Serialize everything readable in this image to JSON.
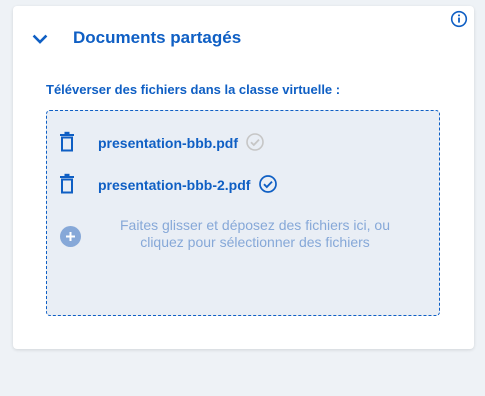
{
  "card": {
    "title": "Documents partagés",
    "upload_label": "Téléverser des fichiers dans la classe virtuelle :",
    "files": [
      {
        "name": "presentation-bbb.pdf",
        "status_icon": "check-circle-icon",
        "status": "inactive"
      },
      {
        "name": "presentation-bbb-2.pdf",
        "status_icon": "check-circle-icon",
        "status": "active"
      }
    ],
    "drop_hint_line1": "Faites glisser et déposez des fichiers ici, ou",
    "drop_hint_line2": "cliquez pour sélectionner des fichiers"
  },
  "colors": {
    "accent": "#0f5fc4",
    "hint": "#86a8d8",
    "dropzone_bg": "#e9eef5",
    "inactive_check": "#c6c6c6",
    "page_bg": "#eef2f6"
  }
}
